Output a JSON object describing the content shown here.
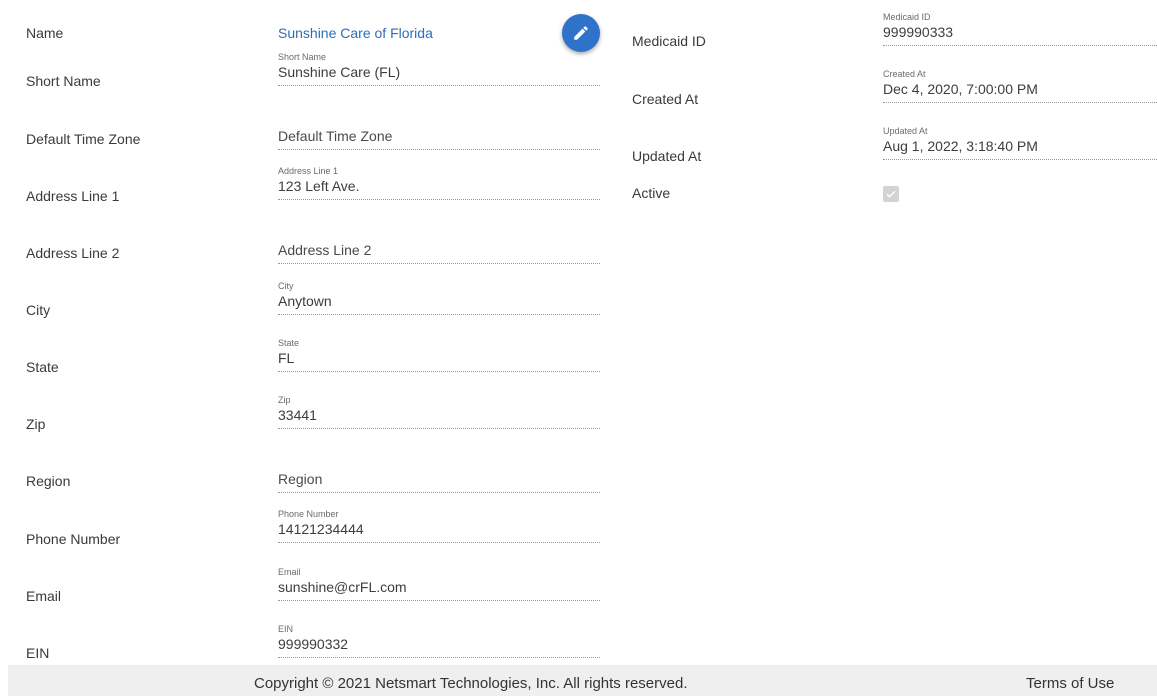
{
  "left_labels": {
    "name": "Name",
    "short_name": "Short Name",
    "default_time_zone": "Default Time Zone",
    "address_line_1": "Address Line 1",
    "address_line_2": "Address Line 2",
    "city": "City",
    "state": "State",
    "zip": "Zip",
    "region": "Region",
    "phone_number": "Phone Number",
    "email": "Email",
    "ein": "EIN"
  },
  "fields": {
    "name_value": "Sunshine Care of Florida",
    "short_name": {
      "label": "Short Name",
      "value": "Sunshine Care (FL)"
    },
    "default_time_zone": {
      "placeholder": "Default Time Zone",
      "value": ""
    },
    "address_line_1": {
      "label": "Address Line 1",
      "value": "123 Left Ave."
    },
    "address_line_2": {
      "placeholder": "Address Line 2",
      "value": ""
    },
    "city": {
      "label": "City",
      "value": "Anytown"
    },
    "state": {
      "label": "State",
      "value": "FL"
    },
    "zip": {
      "label": "Zip",
      "value": "33441"
    },
    "region": {
      "placeholder": "Region",
      "value": ""
    },
    "phone_number": {
      "label": "Phone Number",
      "value": "14121234444"
    },
    "email": {
      "label": "Email",
      "value": "sunshine@crFL.com"
    },
    "ein": {
      "label": "EIN",
      "value": "999990332"
    }
  },
  "right_labels": {
    "medicaid_id": "Medicaid ID",
    "created_at": "Created At",
    "updated_at": "Updated At",
    "active": "Active"
  },
  "right_fields": {
    "medicaid_id": {
      "label": "Medicaid ID",
      "value": "999990333"
    },
    "created_at": {
      "label": "Created At",
      "value": "Dec 4, 2020, 7:00:00 PM"
    },
    "updated_at": {
      "label": "Updated At",
      "value": "Aug 1, 2022, 3:18:40 PM"
    },
    "active": {
      "checked": true,
      "disabled": true
    }
  },
  "edit_button": {
    "icon": "pencil-icon",
    "color": "#2f72c9"
  },
  "footer": {
    "copyright": "Copyright © 2021 Netsmart Technologies, Inc. All rights reserved.",
    "terms": "Terms of Use"
  }
}
